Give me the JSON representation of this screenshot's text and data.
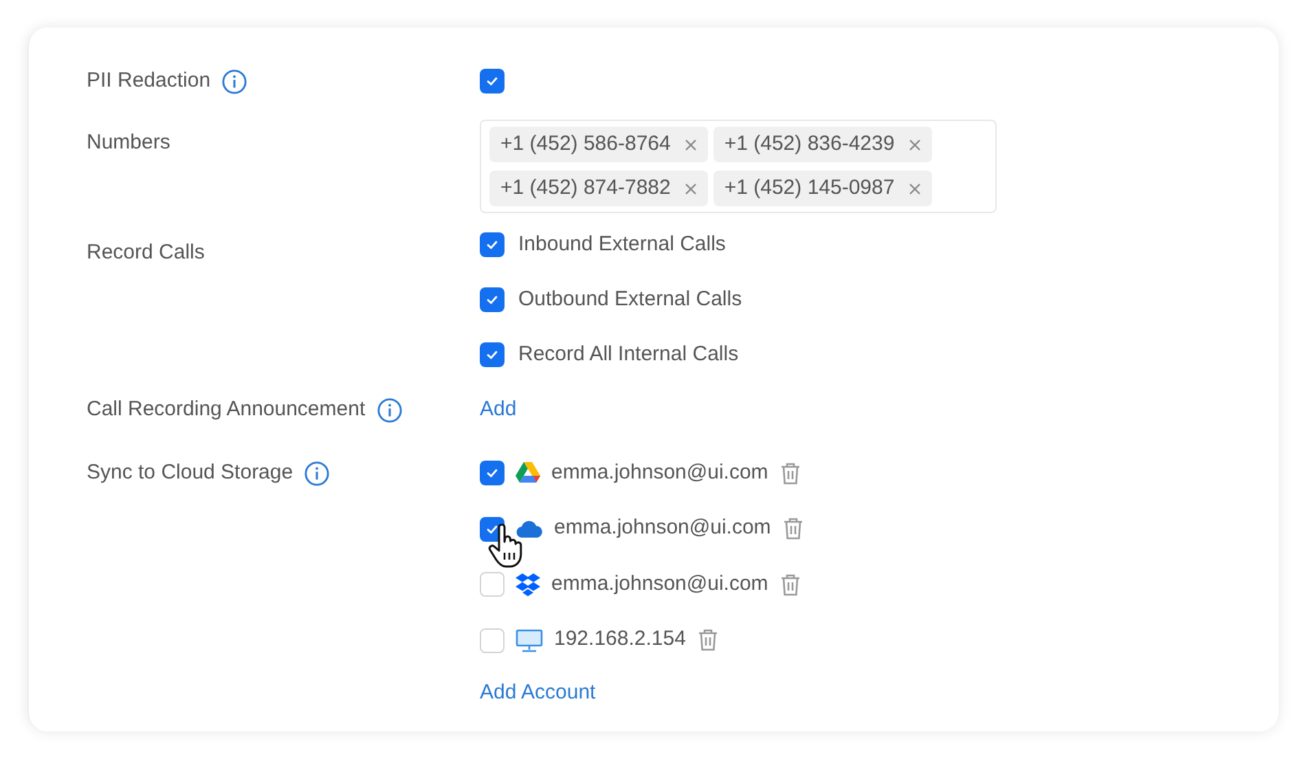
{
  "settings": [
    {
      "kind": "checkbox",
      "label": "PII Redaction",
      "info": true,
      "checked": true
    },
    {
      "kind": "tags",
      "label": "Numbers",
      "tags": [
        "+1 (452) 586-8764",
        "+1 (452) 836-4239",
        "+1 (452) 874-7882",
        "+1 (452) 145-0987"
      ]
    },
    {
      "kind": "checklist",
      "label": "Record Calls",
      "options": [
        {
          "label": "Inbound External Calls",
          "checked": true
        },
        {
          "label": "Outbound External Calls",
          "checked": true
        },
        {
          "label": "Record All Internal Calls",
          "checked": true
        }
      ]
    },
    {
      "kind": "link",
      "label": "Call Recording Announcement",
      "info": true,
      "link": "Add"
    },
    {
      "kind": "accounts",
      "label": "Sync to Cloud Storage",
      "info": true,
      "link": "Add Account",
      "accounts": [
        {
          "kind": "drive",
          "name": "emma.johnson@ui.com",
          "checked": true
        },
        {
          "kind": "cloud",
          "name": "emma.johnson@ui.com",
          "checked": true,
          "hovered": true
        },
        {
          "kind": "dropbox",
          "name": "emma.johnson@ui.com",
          "checked": false
        },
        {
          "kind": "server",
          "name": "192.168.2.154",
          "checked": false
        }
      ]
    }
  ]
}
